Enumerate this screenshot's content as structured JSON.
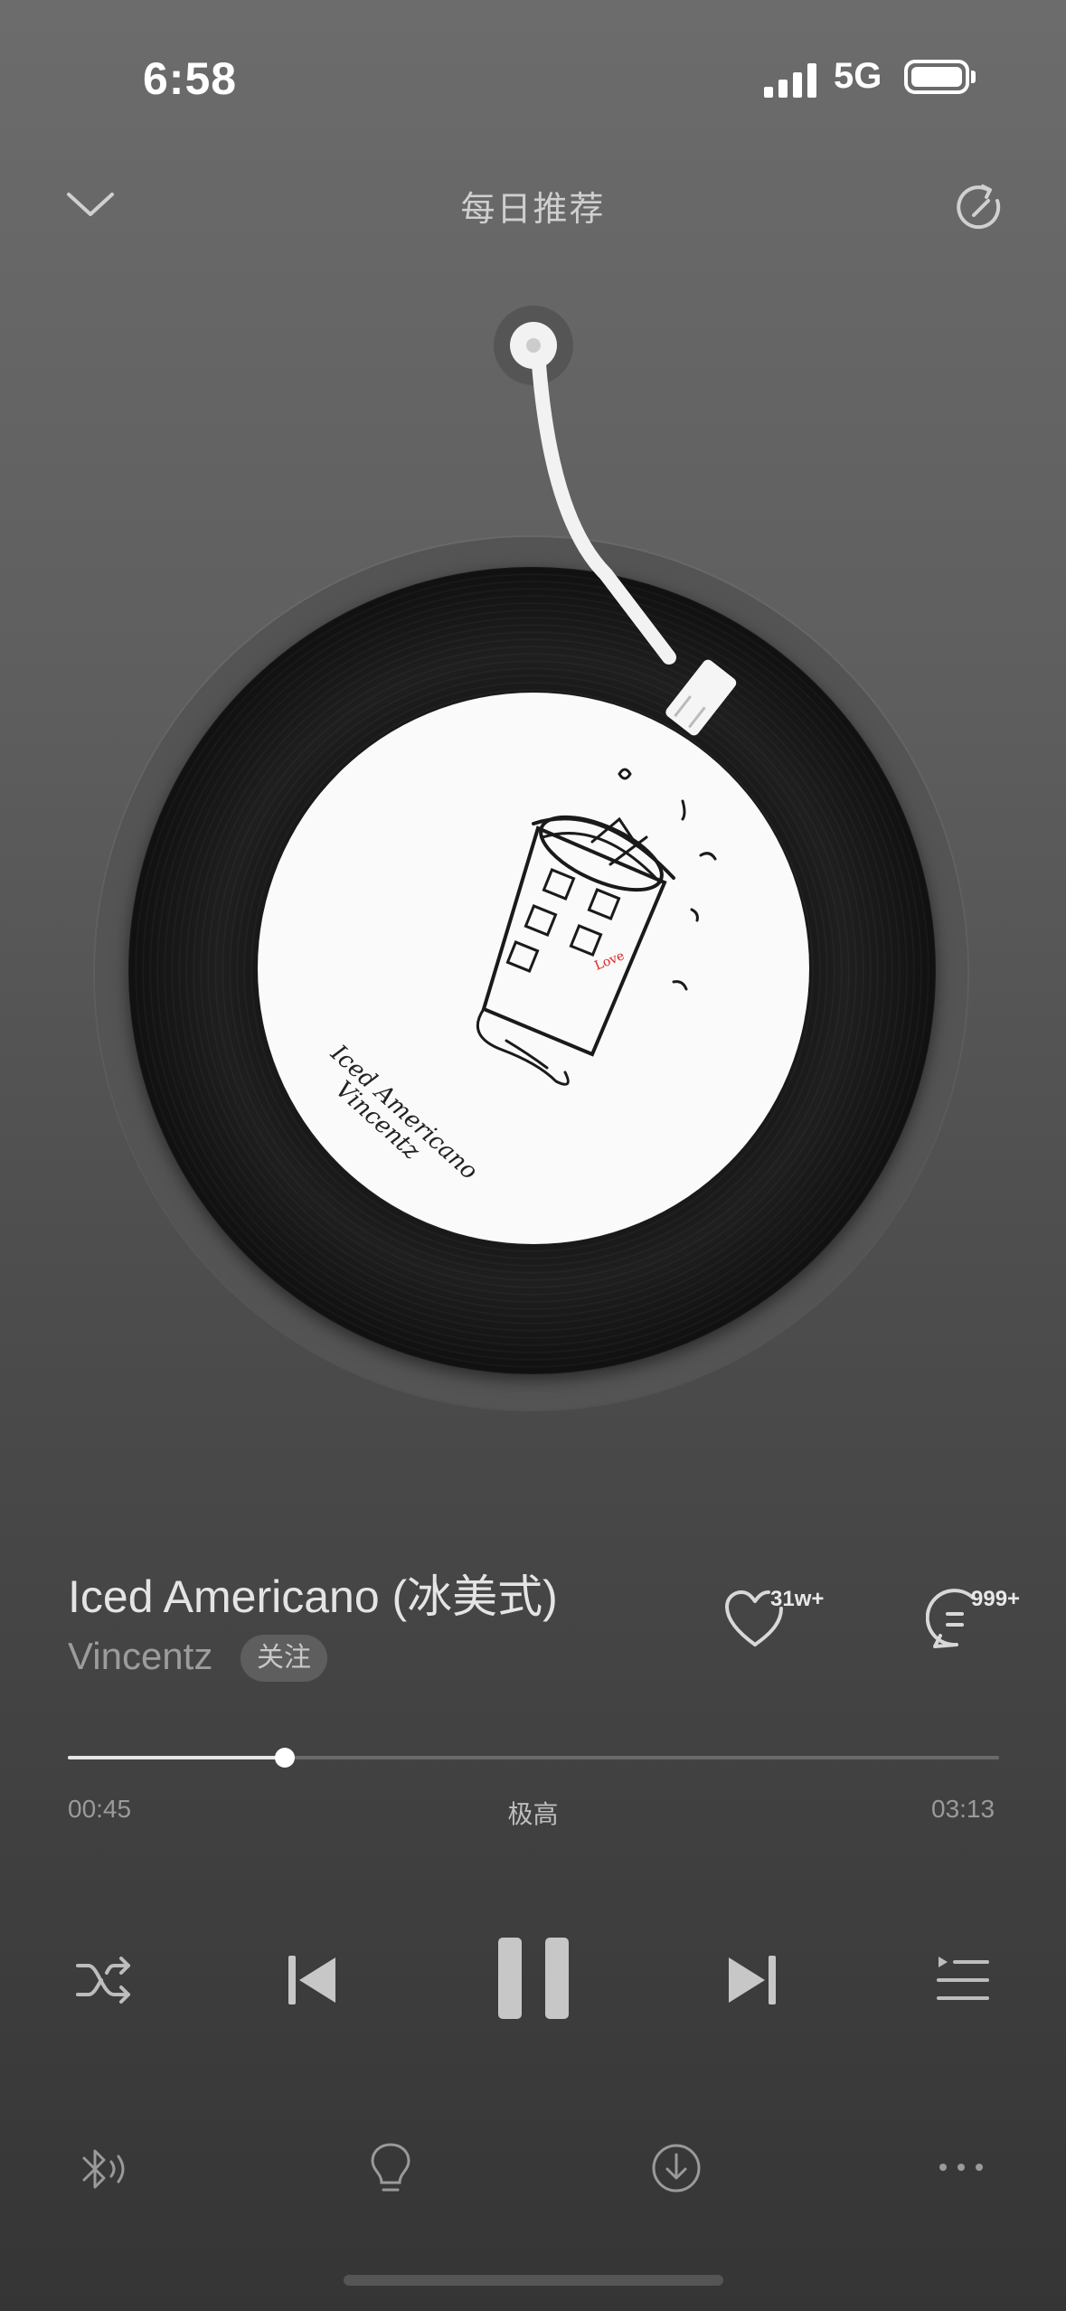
{
  "status_bar": {
    "time": "6:58",
    "network": "5G",
    "battery_level": 1.0
  },
  "header": {
    "title": "每日推荐"
  },
  "album_art": {
    "line1": "Iced Americano",
    "line2": "Vincentz",
    "icon": "coffee-cup-sketch"
  },
  "song": {
    "title": "Iced Americano (冰美式)",
    "artist": "Vincentz",
    "follow_label": "关注",
    "like_count": "31w+",
    "comment_count": "999+"
  },
  "player": {
    "current_time": "00:45",
    "total_time": "03:13",
    "quality": "极高",
    "progress": 0.233
  },
  "colors": {
    "accent": "#ffffff",
    "muted": "#9a9a9a"
  }
}
